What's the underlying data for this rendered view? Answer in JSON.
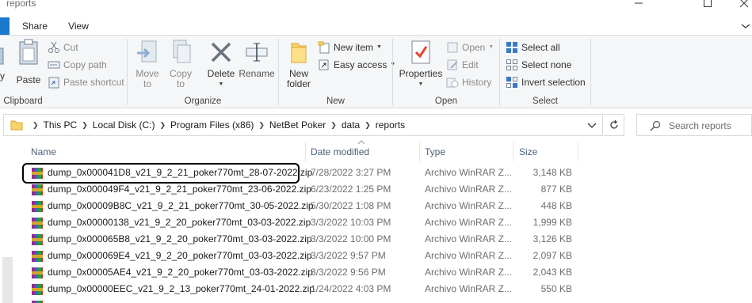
{
  "window": {
    "title": "reports"
  },
  "tabs": [
    {
      "label": "Share"
    },
    {
      "label": "View"
    }
  ],
  "ribbon": {
    "clipboard": {
      "label": "Clipboard",
      "pin_fragment": "y",
      "paste": "Paste",
      "cut": "Cut",
      "copy_path": "Copy path",
      "paste_shortcut": "Paste shortcut"
    },
    "organize": {
      "label": "Organize",
      "move_to_1": "Move",
      "move_to_2": "to",
      "copy_to_1": "Copy",
      "copy_to_2": "to",
      "delete": "Delete",
      "rename": "Rename"
    },
    "new": {
      "label": "New",
      "new_folder_1": "New",
      "new_folder_2": "folder",
      "new_item": "New item",
      "easy_access": "Easy access"
    },
    "open": {
      "label": "Open",
      "properties": "Properties",
      "open": "Open",
      "edit": "Edit",
      "history": "History"
    },
    "select": {
      "label": "Select",
      "select_all": "Select all",
      "select_none": "Select none",
      "invert_selection": "Invert selection"
    }
  },
  "address": {
    "crumbs": [
      "This PC",
      "Local Disk (C:)",
      "Program Files (x86)",
      "NetBet Poker",
      "data",
      "reports"
    ]
  },
  "search": {
    "placeholder": "Search reports"
  },
  "columns": {
    "name": "Name",
    "date": "Date modified",
    "type": "Type",
    "size": "Size"
  },
  "files": [
    {
      "name": "dump_0x000041D8_v21_9_2_21_poker770mt_28-07-2022.zip",
      "date": "7/28/2022 3:27 PM",
      "type": "Archivo WinRAR Z...",
      "size": "3,148 KB"
    },
    {
      "name": "dump_0x000049F4_v21_9_2_21_poker770mt_23-06-2022.zip",
      "date": "6/23/2022 1:25 PM",
      "type": "Archivo WinRAR Z...",
      "size": "877 KB"
    },
    {
      "name": "dump_0x00009B8C_v21_9_2_21_poker770mt_30-05-2022.zip",
      "date": "5/30/2022 1:08 PM",
      "type": "Archivo WinRAR Z...",
      "size": "448 KB"
    },
    {
      "name": "dump_0x00000138_v21_9_2_20_poker770mt_03-03-2022.zip",
      "date": "3/3/2022 10:03 PM",
      "type": "Archivo WinRAR Z...",
      "size": "1,999 KB"
    },
    {
      "name": "dump_0x000065B8_v21_9_2_20_poker770mt_03-03-2022.zip",
      "date": "3/3/2022 10:00 PM",
      "type": "Archivo WinRAR Z...",
      "size": "3,126 KB"
    },
    {
      "name": "dump_0x000069E4_v21_9_2_20_poker770mt_03-03-2022.zip",
      "date": "3/3/2022 9:57 PM",
      "type": "Archivo WinRAR Z...",
      "size": "2,097 KB"
    },
    {
      "name": "dump_0x00005AE4_v21_9_2_20_poker770mt_03-03-2022.zip",
      "date": "3/3/2022 9:56 PM",
      "type": "Archivo WinRAR Z...",
      "size": "2,043 KB"
    },
    {
      "name": "dump_0x00000EEC_v21_9_2_13_poker770mt_24-01-2022.zip",
      "date": "1/24/2022 4:03 PM",
      "type": "Archivo WinRAR Z...",
      "size": "550 KB"
    }
  ]
}
